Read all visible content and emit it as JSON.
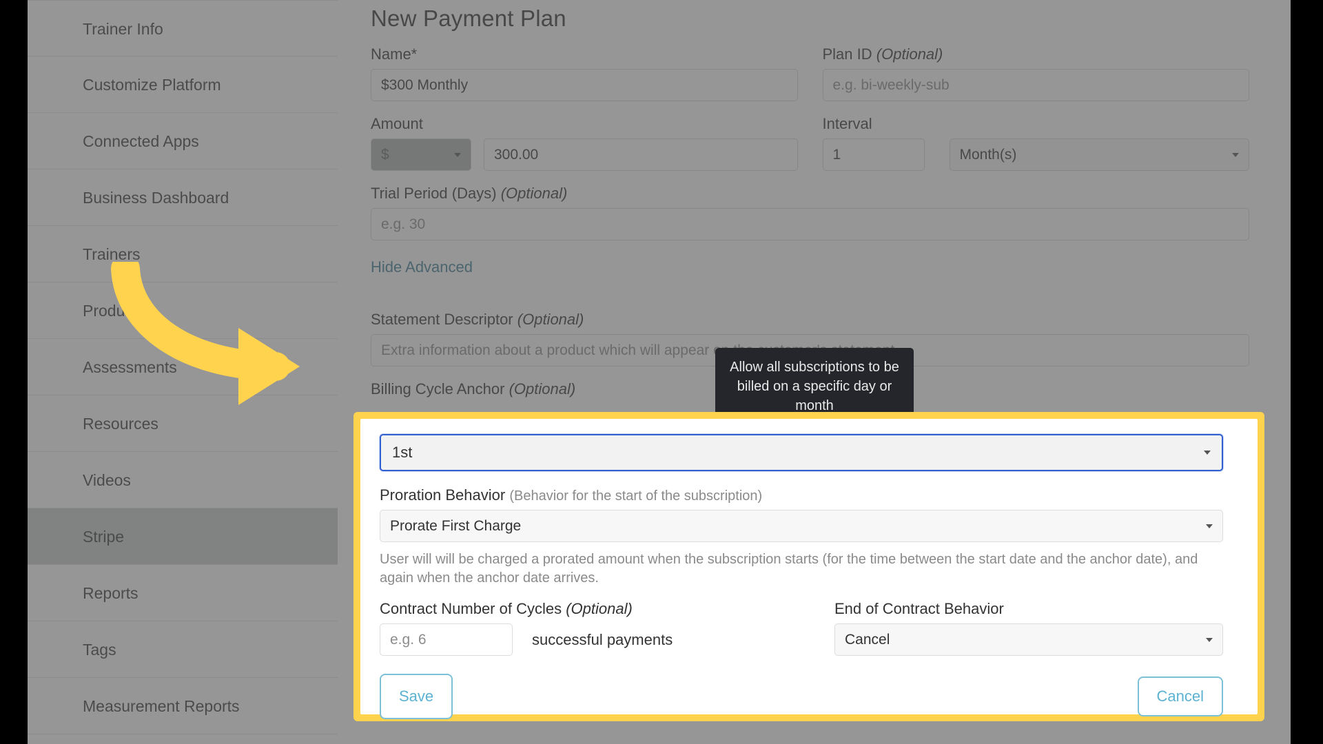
{
  "sidebar": {
    "items": [
      {
        "label": "Trainer Info",
        "active": false
      },
      {
        "label": "Customize Platform",
        "active": false
      },
      {
        "label": "Connected Apps",
        "active": false
      },
      {
        "label": "Business Dashboard",
        "active": false
      },
      {
        "label": "Trainers",
        "active": false
      },
      {
        "label": "Products",
        "active": false
      },
      {
        "label": "Assessments",
        "active": false
      },
      {
        "label": "Resources",
        "active": false
      },
      {
        "label": "Videos",
        "active": false
      },
      {
        "label": "Stripe",
        "active": true
      },
      {
        "label": "Reports",
        "active": false
      },
      {
        "label": "Tags",
        "active": false
      },
      {
        "label": "Measurement Reports",
        "active": false
      }
    ]
  },
  "form": {
    "title": "New Payment Plan",
    "name": {
      "label": "Name*",
      "value": "$300 Monthly"
    },
    "plan_id": {
      "label": "Plan ID",
      "optional": "(Optional)",
      "placeholder": "e.g. bi-weekly-sub"
    },
    "amount": {
      "label": "Amount",
      "currency": "$",
      "value": "300.00"
    },
    "interval": {
      "label": "Interval",
      "count": "1",
      "unit": "Month(s)"
    },
    "trial_period": {
      "label": "Trial Period (Days)",
      "optional": "(Optional)",
      "placeholder": "e.g. 30"
    },
    "advanced_toggle": "Hide Advanced",
    "statement_descriptor": {
      "label": "Statement Descriptor",
      "optional": "(Optional)",
      "placeholder": "Extra information about a product which will appear on the customer's statement"
    },
    "billing_cycle_anchor": {
      "label": "Billing Cycle Anchor",
      "optional": "(Optional)"
    }
  },
  "tooltip": {
    "text": "Allow all subscriptions to be billed on a specific day or month"
  },
  "modal": {
    "anchor_select": {
      "value": "1st"
    },
    "proration": {
      "label": "Proration Behavior",
      "hint": "(Behavior for the start of the subscription)",
      "value": "Prorate First Charge",
      "helper": "User will will be charged a prorated amount when the subscription starts (for the time between the start date and the anchor date), and again when the anchor date arrives."
    },
    "cycles": {
      "label": "Contract Number of Cycles",
      "optional": "(Optional)",
      "placeholder": "e.g. 6",
      "suffix": "successful payments"
    },
    "end_behavior": {
      "label": "End of Contract Behavior",
      "value": "Cancel"
    },
    "save_label": "Save",
    "cancel_label": "Cancel"
  },
  "colors": {
    "highlight": "#ffd34e",
    "link": "#3a7c94",
    "button_border": "#7cc0d8",
    "focus_border": "#2f5fd0",
    "active_nav": "#c8ccce"
  }
}
